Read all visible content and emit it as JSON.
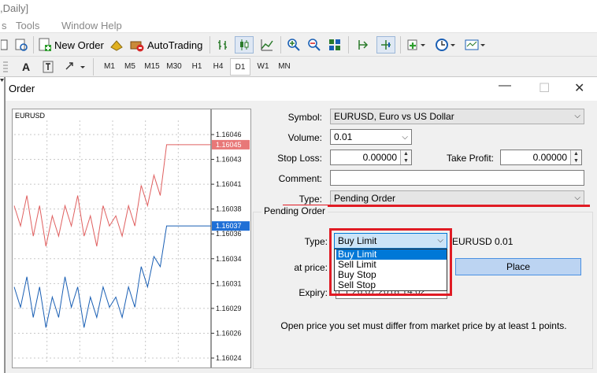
{
  "window": {
    "title_fragment": ",Daily]"
  },
  "menu": [
    "s",
    "Tools",
    "Window",
    "Help"
  ],
  "toolbar": {
    "new_order": "New Order",
    "autotrading": "AutoTrading",
    "text_tool": "A",
    "timeframes": [
      "M1",
      "M5",
      "M15",
      "M30",
      "H1",
      "H4",
      "D1",
      "W1",
      "MN"
    ],
    "active_timeframe": "D1"
  },
  "dialog": {
    "title": "Order",
    "chart_symbol": "EURUSD",
    "symbol_label": "Symbol:",
    "symbol_value": "EURUSD, Euro vs US Dollar",
    "volume_label": "Volume:",
    "volume_value": "0.01",
    "stoploss_label": "Stop Loss:",
    "stoploss_value": "0.00000",
    "takeprofit_label": "Take Profit:",
    "takeprofit_value": "0.00000",
    "comment_label": "Comment:",
    "comment_value": "",
    "type_label": "Type:",
    "type_value": "Pending Order",
    "pending_group_label": "Pending Order",
    "pending_type_label": "Type:",
    "pending_type_value": "Buy Limit",
    "pending_symbol_info": "EURUSD 0.01",
    "pending_type_options": [
      "Buy Limit",
      "Sell Limit",
      "Buy Stop",
      "Sell Stop"
    ],
    "pending_type_selected_index": 0,
    "at_price_label": "at price:",
    "place_button": "Place",
    "expiry_label": "Expiry:",
    "expiry_value": "26.07.2018 14:02",
    "note": "Open price you set must differ from market price by at least 1 points."
  },
  "colors": {
    "ask_line": "#e06060",
    "bid_line": "#1a5fb4",
    "ask_badge": "#e87878",
    "bid_badge": "#1f6fd6",
    "highlight": "#e01b24"
  },
  "chart_data": {
    "type": "line",
    "y_ticks": [
      "1.16046",
      "1.16043",
      "1.16041",
      "1.16038",
      "1.16036",
      "1.16034",
      "1.16031",
      "1.16029",
      "1.16026",
      "1.16024"
    ],
    "ylim": [
      1.16024,
      1.16046
    ],
    "ask_price": "1.16045",
    "bid_price": "1.16037",
    "series": [
      {
        "values": [
          1.16039,
          1.16037,
          1.1604,
          1.16036,
          1.16039,
          1.16035,
          1.16038,
          1.16036,
          1.16039,
          1.16037,
          1.1604,
          1.16036,
          1.16038,
          1.16035,
          1.16039,
          1.16037,
          1.16038,
          1.16036,
          1.16039,
          1.16037,
          1.16041,
          1.16039,
          1.16042,
          1.1604,
          1.16045,
          1.16045,
          1.16045,
          1.16045,
          1.16045,
          1.16045,
          1.16045,
          1.16045
        ]
      },
      {
        "values": [
          1.16031,
          1.16029,
          1.16032,
          1.16028,
          1.16031,
          1.16027,
          1.1603,
          1.16028,
          1.16032,
          1.16029,
          1.16031,
          1.16027,
          1.1603,
          1.16028,
          1.16031,
          1.16029,
          1.1603,
          1.16028,
          1.16031,
          1.16029,
          1.16033,
          1.16031,
          1.16034,
          1.16033,
          1.16037,
          1.16037,
          1.16037,
          1.16037,
          1.16037,
          1.16037,
          1.16037,
          1.16037
        ]
      }
    ]
  }
}
